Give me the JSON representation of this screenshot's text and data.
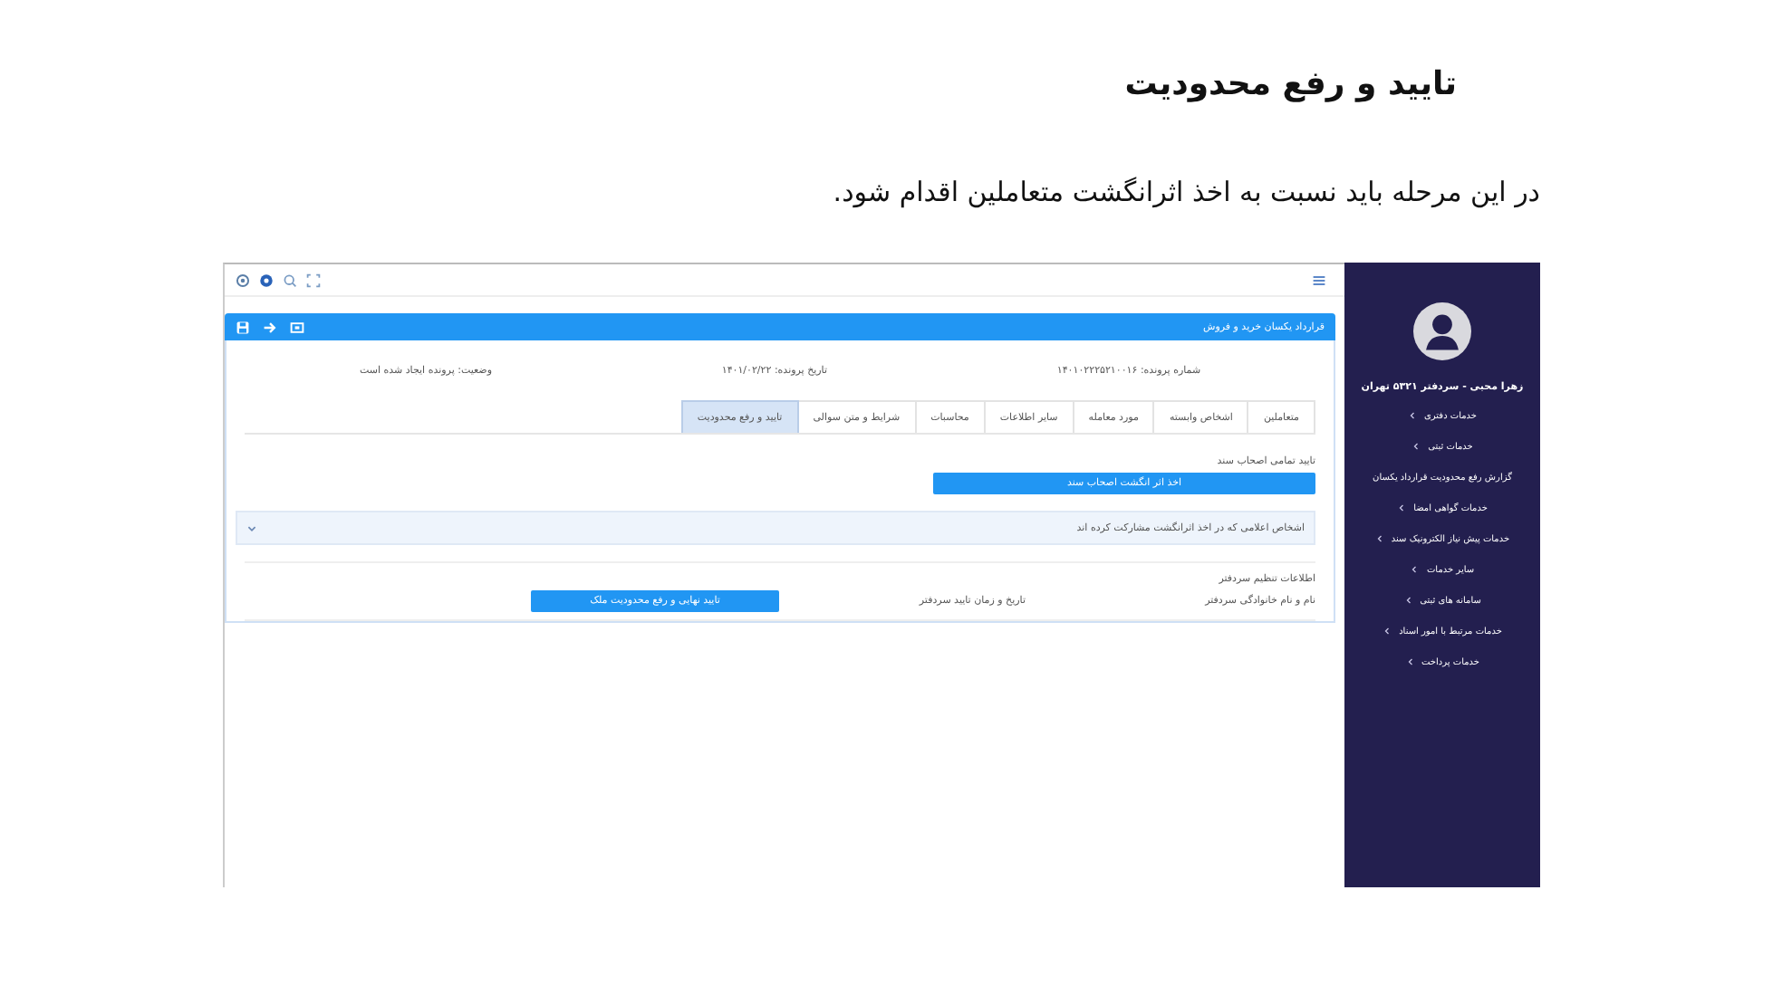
{
  "document": {
    "heading": "تایید و رفع محدودیت",
    "paragraph": "در این مرحله باید نسبت به اخذ اثرانگشت متعاملین اقدام شود."
  },
  "app": {
    "panel_title": "قرارداد یکسان خرید و فروش",
    "file_info": [
      "شماره پرونده: ۱۴۰۱۰۲۲۲۵۲۱۰۰۱۶",
      "تاریخ پرونده: ۱۴۰۱/۰۲/۲۲",
      "وضعیت: پرونده ایجاد شده است"
    ],
    "tabs": [
      {
        "label": "متعاملین",
        "selected": false
      },
      {
        "label": "اشخاص وابسته",
        "selected": false
      },
      {
        "label": "مورد معامله",
        "selected": false
      },
      {
        "label": "سایر اطلاعات",
        "selected": false
      },
      {
        "label": "محاسبات",
        "selected": false
      },
      {
        "label": "شرایط و متن سوالی",
        "selected": false
      },
      {
        "label": "تایید و رفع محدودیت",
        "selected": true
      }
    ],
    "approval_label": "تایید تمامی اصحاب سند",
    "fingerprint_button": "اخذ اثر انگشت اصحاب سند",
    "accordion": {
      "title": "اشخاص اعلامی که در اخذ اثرانگشت مشارکت کرده اند",
      "expanded": false
    },
    "notary": {
      "title": "اطلاعات تنظیم سردفتر",
      "name_label": "نام و نام خانوادگی سردفتر",
      "datetime_label": "تاریخ و زمان تایید سردفتر",
      "final_button": "تایید نهایی و رفع محدودیت ملک"
    },
    "sidebar": {
      "user_name": "زهرا محبی - سردفتر ۵۳۲۱ تهران",
      "items": [
        {
          "label": "خدمات دفتری",
          "has_submenu": true
        },
        {
          "label": "خدمات ثبتی",
          "has_submenu": true
        },
        {
          "label": "گزارش رفع محدودیت قرارداد یکسان",
          "has_submenu": false
        },
        {
          "label": "خدمات گواهی امضا",
          "has_submenu": true
        },
        {
          "label": "خدمات پیش نیاز الکترونیک سند",
          "has_submenu": true
        },
        {
          "label": "سایر خدمات",
          "has_submenu": true
        },
        {
          "label": "سامانه های ثبتی",
          "has_submenu": true
        },
        {
          "label": "خدمات مرتبط با امور اسناد",
          "has_submenu": true
        },
        {
          "label": "خدمات پرداخت",
          "has_submenu": true
        }
      ]
    }
  }
}
